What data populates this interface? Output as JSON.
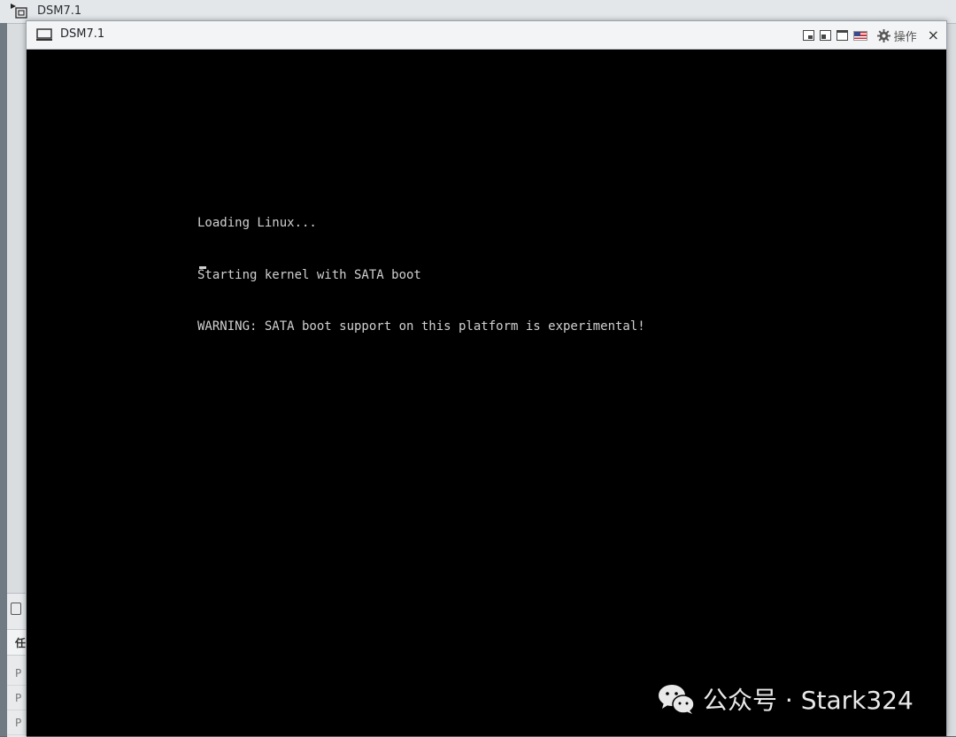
{
  "background_window": {
    "title": "DSM7.1",
    "panel_header": "任",
    "panel_rows": [
      "P",
      "P",
      "P"
    ]
  },
  "console_window": {
    "title": "DSM7.1",
    "toolbar": {
      "actions_label": "操作",
      "close_label": "×"
    }
  },
  "console_output": {
    "lines": [
      "Loading Linux...",
      "Starting kernel with SATA boot",
      "WARNING: SATA boot support on this platform is experimental!"
    ]
  },
  "watermark": {
    "text": "公众号 · Stark324"
  },
  "colors": {
    "console_bg": "#000000",
    "console_text": "#d0d0d0",
    "titlebar_bg": "#f3f4f5"
  }
}
